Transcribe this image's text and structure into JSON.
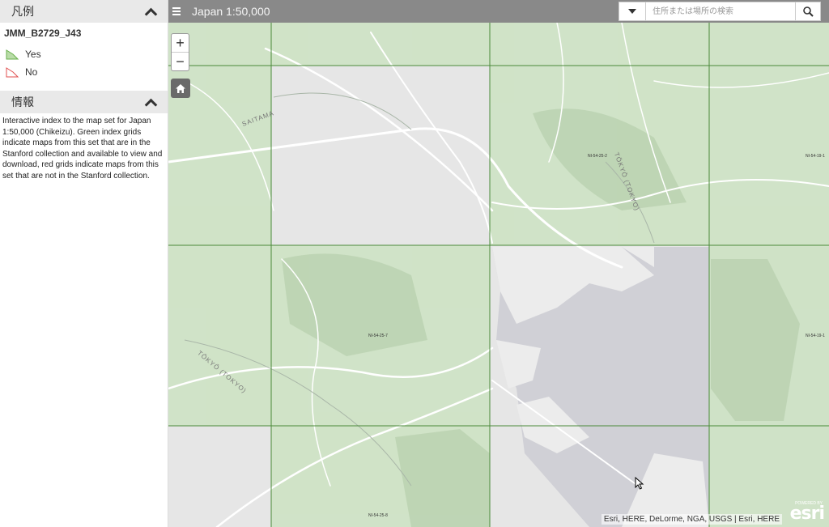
{
  "legend": {
    "title": "凡例",
    "layer_name": "JMM_B2729_J43",
    "items": [
      {
        "label": "Yes",
        "color": "#6ab04c"
      },
      {
        "label": "No",
        "color": "#e05050"
      }
    ]
  },
  "info": {
    "title": "情報",
    "text": "Interactive index to the map set for Japan 1:50,000 (Chikeizu). Green index grids indicate maps from this set that are in the Stanford collection and available to view and download, red grids indicate maps from this set that are not in the Stanford collection."
  },
  "header": {
    "title": "Japan 1:50,000",
    "search_placeholder": "住所または場所の検索"
  },
  "zoom": {
    "in": "+",
    "out": "−"
  },
  "map": {
    "grid_labels": [
      "NI-54-25-2",
      "NI-54-19-1",
      "NI-54-25-7",
      "NI-54-19-1",
      "NI-54-25-8"
    ],
    "place_labels": [
      "SAITAMA",
      "TŌKYŌ (TOKYO)",
      "TŌKYŌ (TOKYO)"
    ],
    "attribution": "Esri, HERE, DeLorme, NGA, USGS | Esri, HERE",
    "logo": "esri",
    "powered_by": "POWERED BY",
    "covered_color": "#cfe3c6",
    "grid_color": "#4a8a3a"
  }
}
